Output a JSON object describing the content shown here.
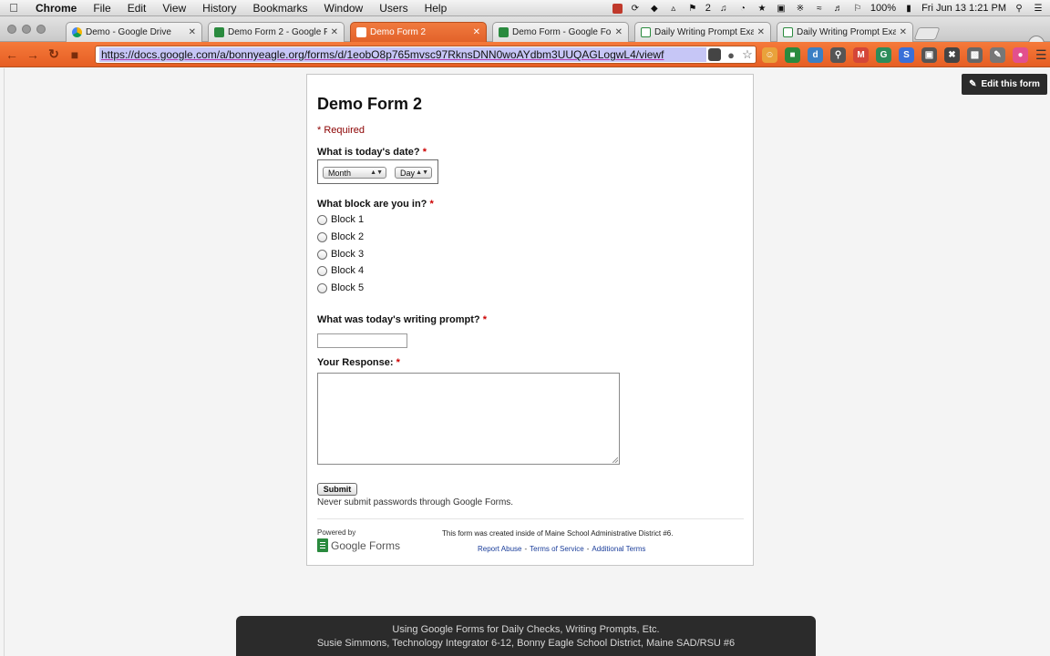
{
  "menubar": {
    "app": "Chrome",
    "items": [
      "File",
      "Edit",
      "View",
      "History",
      "Bookmarks",
      "Window",
      "Users",
      "Help"
    ],
    "status_badge": "2",
    "battery": "100%",
    "clock": "Fri Jun 13  1:21 PM"
  },
  "tabs": [
    {
      "label": "Demo - Google Drive",
      "icon": "drive-icon"
    },
    {
      "label": "Demo Form 2 - Google Fo",
      "icon": "forms-icon"
    },
    {
      "label": "Demo Form 2",
      "icon": "forms-icon",
      "active": true
    },
    {
      "label": "Demo Form - Google Form",
      "icon": "forms-icon"
    },
    {
      "label": "Daily Writing Prompt Exam",
      "icon": "sheets-icon"
    },
    {
      "label": "Daily Writing Prompt Exam",
      "icon": "sheets-icon"
    }
  ],
  "toolbar": {
    "url": "https://docs.google.com/a/bonnyeagle.org/forms/d/1eobO8p765mvsc97RknsDNN0woAYdbm3UUQAGLogwL4/viewf"
  },
  "page": {
    "edit_button": "Edit this form"
  },
  "form": {
    "title": "Demo Form 2",
    "required_note": "* Required",
    "q_date": "What is today's date?",
    "month_select": "Month",
    "day_select": "Day",
    "q_block": "What block are you in?",
    "blocks": [
      "Block 1",
      "Block 2",
      "Block 3",
      "Block 4",
      "Block 5"
    ],
    "q_prompt": "What was today's writing prompt?",
    "q_response": "Your Response:",
    "required_star": "*",
    "submit": "Submit",
    "never_note": "Never submit passwords through Google Forms.",
    "powered_by": "Powered by",
    "gf_logo_text": "Google Forms",
    "created_note": "This form was created inside of Maine School Administrative District #6.",
    "links": [
      "Report Abuse",
      "Terms of Service",
      "Additional Terms"
    ],
    "link_sep": "-"
  },
  "caption": {
    "line1": "Using Google Forms for Daily Checks, Writing Prompts, Etc.",
    "line2": "Susie Simmons, Technology Integrator 6-12, Bonny Eagle School District, Maine SAD/RSU #6"
  }
}
